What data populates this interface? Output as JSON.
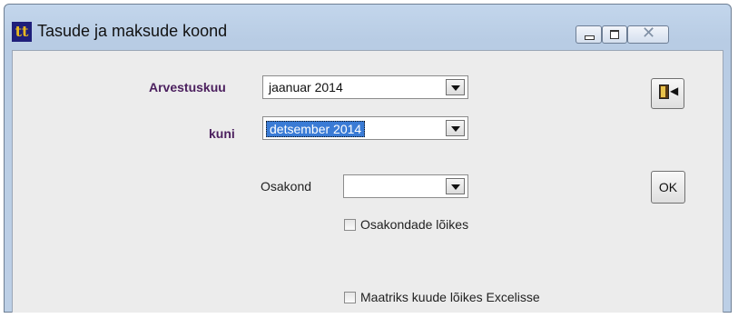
{
  "window": {
    "title": "Tasude ja maksude koond",
    "icon": "app-logo-icon",
    "app_icon_text": "tt"
  },
  "form": {
    "period_label": "Arvestuskuu",
    "period_from": "jaanuar  2014",
    "until_label": "kuni",
    "period_to": "detsember  2014",
    "department_label": "Osakond",
    "department_value": "",
    "by_department_label": "Osakondade lõikes",
    "by_department_checked": false,
    "matrix_label": "Maatriks kuude lõikes Excelisse",
    "matrix_checked": false
  },
  "buttons": {
    "exit_icon": "exit-door-icon",
    "ok_label": "OK"
  },
  "colors": {
    "label_accent": "#4b1f5e",
    "selection": "#3a7bd5",
    "titlebar": "#c3d6ec"
  }
}
